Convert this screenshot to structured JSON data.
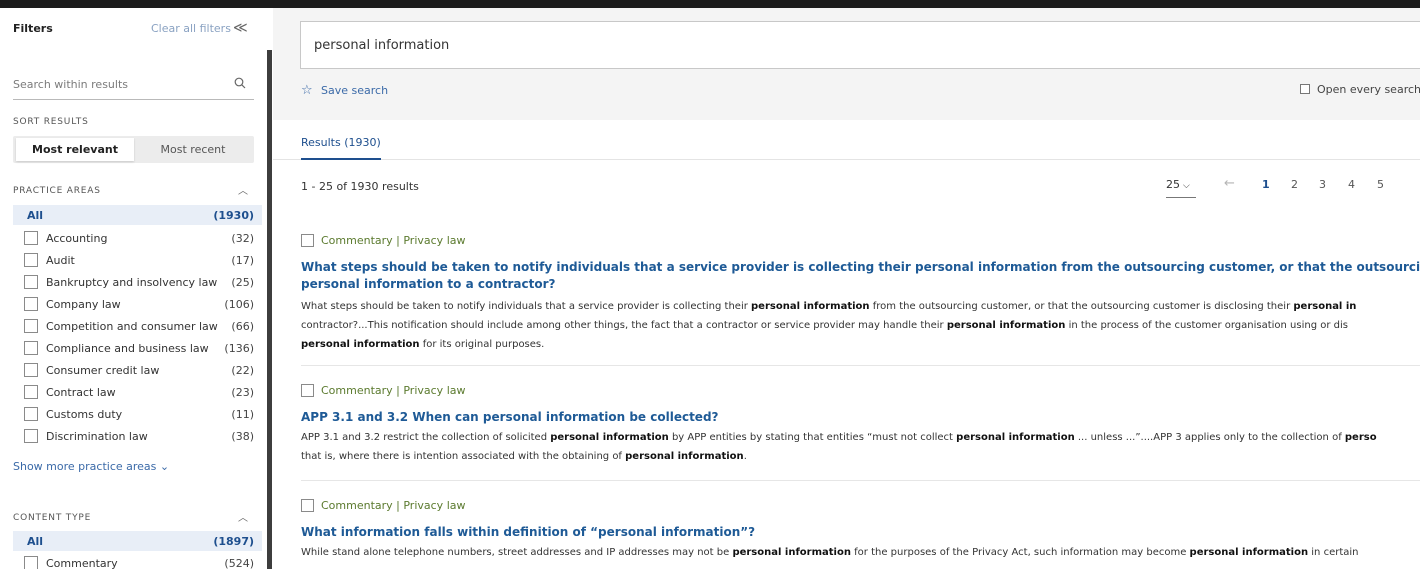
{
  "sidebar": {
    "title": "Filters",
    "clear_all": "Clear all filters",
    "collapse_glyph": "≪",
    "search_placeholder": "Search within results",
    "sort_label": "SORT RESULTS",
    "sort_options": [
      "Most relevant",
      "Most recent"
    ],
    "sort_selected": "Most relevant",
    "practice_areas": {
      "label": "PRACTICE AREAS",
      "all_label": "All",
      "all_count": "(1930)",
      "items": [
        {
          "label": "Accounting",
          "count": "(32)"
        },
        {
          "label": "Audit",
          "count": "(17)"
        },
        {
          "label": "Bankruptcy and insolvency law",
          "count": "(25)"
        },
        {
          "label": "Company law",
          "count": "(106)"
        },
        {
          "label": "Competition and consumer law",
          "count": "(66)"
        },
        {
          "label": "Compliance and business law",
          "count": "(136)"
        },
        {
          "label": "Consumer credit law",
          "count": "(22)"
        },
        {
          "label": "Contract law",
          "count": "(23)"
        },
        {
          "label": "Customs duty",
          "count": "(11)"
        },
        {
          "label": "Discrimination law",
          "count": "(38)"
        }
      ],
      "show_more": "Show more practice areas ⌄"
    },
    "content_type": {
      "label": "CONTENT TYPE",
      "all_label": "All",
      "all_count": "(1897)",
      "items": [
        {
          "label": "Commentary",
          "count": "(524)"
        }
      ]
    }
  },
  "main": {
    "search_value": "personal information",
    "save_search": "Save search",
    "open_every_search": "Open every search",
    "tab_results": "Results (1930)",
    "range_text": "1 - 25 of 1930 results",
    "per_page": "25",
    "pages": [
      "1",
      "2",
      "3",
      "4",
      "5"
    ],
    "current_page": "1",
    "results": [
      {
        "tag": "Commentary | Privacy law",
        "title_line1": "What steps should be taken to notify individuals that a service provider is collecting their personal information from the outsourcing customer, or that the outsourcing customer is d",
        "title_line2": "personal information to a contractor?",
        "snippet_lines": [
          "What steps should be taken to notify individuals that a service provider is collecting their <b>personal information</b> from the outsourcing customer, or that the outsourcing customer is disclosing their <b>personal in</b>",
          "contractor?...This notification should include among other things, the fact that a contractor or service provider may handle their <b>personal information</b> in the process of the customer organisation using or dis",
          "<b>personal information</b> for its original purposes."
        ]
      },
      {
        "tag": "Commentary | Privacy law",
        "title_line1": "APP 3.1 and 3.2 When can personal information be collected?",
        "snippet_lines": [
          "APP 3.1 and 3.2 restrict the collection of solicited <b>personal information</b> by APP entities by stating that entities “must not collect <b>personal information</b> ... unless ...”....APP 3 applies only to the collection of <b>perso</b>",
          "that is, where there is intention associated with the obtaining of <b>personal information</b>."
        ]
      },
      {
        "tag": "Commentary | Privacy law",
        "title_line1": "What information falls within definition of “personal information”?",
        "snippet_lines": [
          "While stand alone telephone numbers, street addresses and IP addresses may not be <b>personal information</b> for the purposes of the Privacy Act, such information may become <b>personal information</b> in certain"
        ]
      }
    ]
  },
  "colors": {
    "link_blue": "#1e5a96",
    "tag_green": "#5b7a2e",
    "accent": "#1e4f8e"
  }
}
